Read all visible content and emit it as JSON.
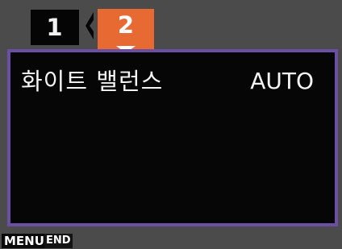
{
  "tabs": [
    {
      "label": "1",
      "active": false
    },
    {
      "label": "2",
      "active": true
    }
  ],
  "icons": {
    "tab_switch": "chevron-left-icon",
    "active_tab_marker": "chevron-down-icon"
  },
  "colors": {
    "active_tab": "#e86a33",
    "panel_border": "#6a4fa4",
    "panel_bg": "#060606",
    "frame_bg": "#4b4b4b"
  },
  "setting": {
    "label": "화이트 밸런스",
    "value": "AUTO"
  },
  "footer": {
    "menu_key": "MENU",
    "end_label": "END"
  }
}
